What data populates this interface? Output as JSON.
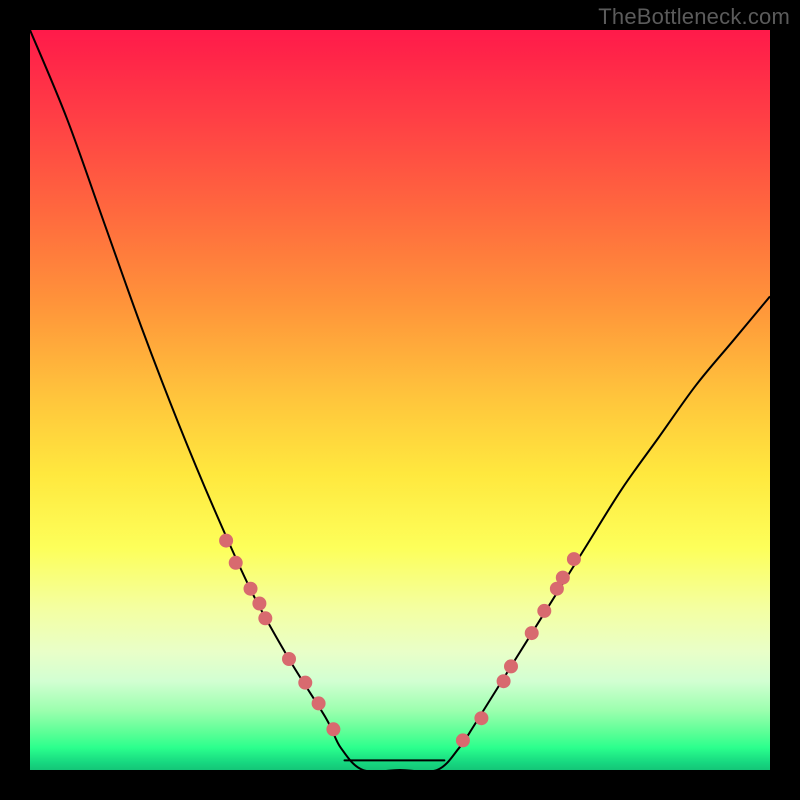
{
  "watermark": "TheBottleneck.com",
  "chart_data": {
    "type": "line",
    "title": "",
    "xlabel": "",
    "ylabel": "",
    "x": [
      0.0,
      0.05,
      0.1,
      0.15,
      0.2,
      0.25,
      0.3,
      0.35,
      0.4,
      0.42,
      0.45,
      0.5,
      0.55,
      0.58,
      0.6,
      0.65,
      0.7,
      0.75,
      0.8,
      0.85,
      0.9,
      0.95,
      1.0
    ],
    "y": [
      1.0,
      0.88,
      0.74,
      0.6,
      0.47,
      0.35,
      0.24,
      0.15,
      0.07,
      0.03,
      0.0,
      0.0,
      0.0,
      0.03,
      0.06,
      0.14,
      0.22,
      0.3,
      0.38,
      0.45,
      0.52,
      0.58,
      0.64
    ],
    "xlim": [
      0,
      1
    ],
    "ylim": [
      0,
      1
    ],
    "markers_left": [
      {
        "x": 0.265,
        "y": 0.31
      },
      {
        "x": 0.278,
        "y": 0.28
      },
      {
        "x": 0.298,
        "y": 0.245
      },
      {
        "x": 0.31,
        "y": 0.225
      },
      {
        "x": 0.318,
        "y": 0.205
      },
      {
        "x": 0.35,
        "y": 0.15
      },
      {
        "x": 0.372,
        "y": 0.118
      },
      {
        "x": 0.39,
        "y": 0.09
      },
      {
        "x": 0.41,
        "y": 0.055
      }
    ],
    "markers_right": [
      {
        "x": 0.585,
        "y": 0.04
      },
      {
        "x": 0.61,
        "y": 0.07
      },
      {
        "x": 0.64,
        "y": 0.12
      },
      {
        "x": 0.65,
        "y": 0.14
      },
      {
        "x": 0.678,
        "y": 0.185
      },
      {
        "x": 0.695,
        "y": 0.215
      },
      {
        "x": 0.712,
        "y": 0.245
      },
      {
        "x": 0.72,
        "y": 0.26
      },
      {
        "x": 0.735,
        "y": 0.285
      }
    ],
    "flat_segment": {
      "x0": 0.425,
      "x1": 0.56,
      "y": 0.013
    }
  }
}
